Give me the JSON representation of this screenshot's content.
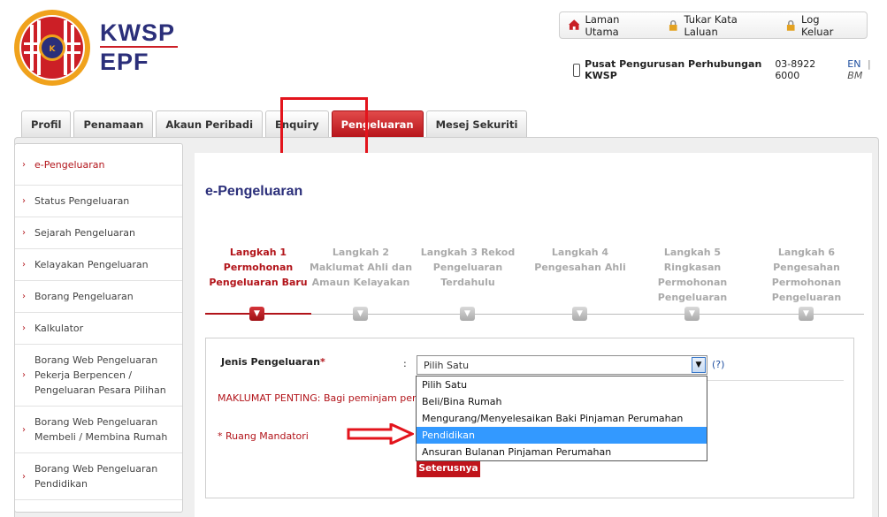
{
  "brand": {
    "kwsp": "KWSP",
    "epf": "EPF"
  },
  "topnav": [
    {
      "label": "Laman Utama",
      "icon": "home-icon"
    },
    {
      "label": "Tukar Kata Laluan",
      "icon": "lock-icon"
    },
    {
      "label": "Log Keluar",
      "icon": "lock-icon"
    }
  ],
  "contact": {
    "label": "Pusat Pengurusan Perhubungan KWSP",
    "phone": "03-8922 6000"
  },
  "lang": {
    "en": "EN",
    "sep": "|",
    "bm": "BM"
  },
  "tabs": [
    {
      "label": "Profil"
    },
    {
      "label": "Penamaan"
    },
    {
      "label": "Akaun Peribadi"
    },
    {
      "label": "Enquiry"
    },
    {
      "label": "Pengeluaran",
      "active": true
    },
    {
      "label": "Mesej Sekuriti"
    }
  ],
  "sidebar": [
    {
      "label": "e-Pengeluaran",
      "active": true
    },
    {
      "label": "Status Pengeluaran"
    },
    {
      "label": "Sejarah Pengeluaran"
    },
    {
      "label": "Kelayakan Pengeluaran"
    },
    {
      "label": "Borang Pengeluaran"
    },
    {
      "label": "Kalkulator"
    },
    {
      "label": "Borang Web Pengeluaran Pekerja Berpencen / Pengeluaran Pesara Pilihan"
    },
    {
      "label": "Borang Web Pengeluaran Membeli / Membina Rumah"
    },
    {
      "label": "Borang Web Pengeluaran Pendidikan"
    }
  ],
  "page_title": "e-Pengeluaran",
  "steps": [
    {
      "label": "Langkah 1 Permohonan Pengeluaran Baru",
      "active": true
    },
    {
      "label": "Langkah 2 Maklumat Ahli dan Amaun Kelayakan"
    },
    {
      "label": "Langkah 3 Rekod Pengeluaran Terdahulu"
    },
    {
      "label": "Langkah 4 Pengesahan Ahli"
    },
    {
      "label": "Langkah 5 Ringkasan Permohonan Pengeluaran"
    },
    {
      "label": "Langkah 6 Pengesahan Permohonan Pengeluaran"
    }
  ],
  "form": {
    "field_label": "Jenis Pengeluaran",
    "required_mark": "*",
    "colon": ":",
    "selected": "Pilih Satu",
    "help": "(?)",
    "important": "MAKLUMAT PENTING: Bagi peminjam peru",
    "mandatory": "* Ruang Mandatori",
    "next_button": "Seterusnya"
  },
  "dropdown_options": [
    {
      "label": "Pilih Satu"
    },
    {
      "label": "Beli/Bina Rumah"
    },
    {
      "label": "Mengurang/Menyelesaikan Baki Pinjaman Perumahan"
    },
    {
      "label": "Pendidikan",
      "highlighted": true
    },
    {
      "label": "Ansuran Bulanan Pinjaman Perumahan"
    }
  ],
  "colors": {
    "accent": "#b2141a",
    "brand_blue": "#2b2f7a",
    "highlight": "#3399ff"
  }
}
